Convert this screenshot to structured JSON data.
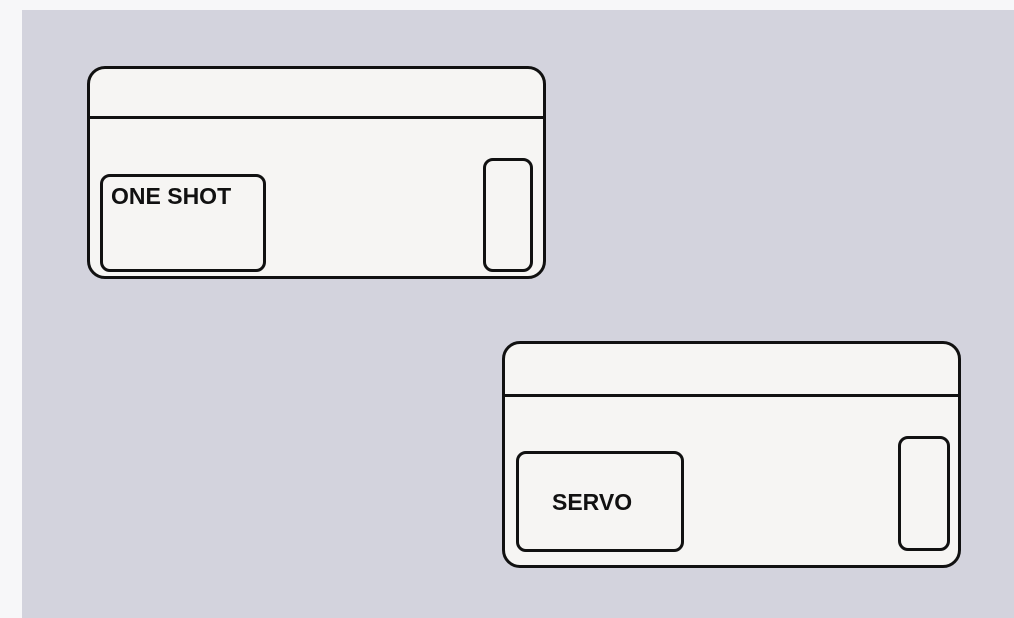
{
  "panels": [
    {
      "mode_label": "ONE SHOT"
    },
    {
      "mode_label": "SERVO"
    }
  ]
}
